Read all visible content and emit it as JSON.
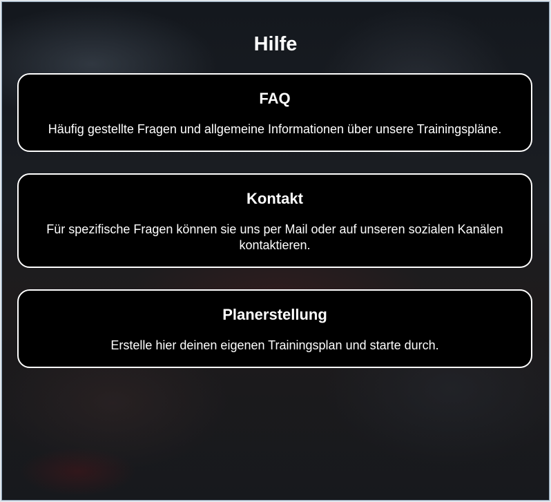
{
  "page": {
    "title": "Hilfe"
  },
  "cards": [
    {
      "title": "FAQ",
      "text": "Häufig gestellte Fragen und allgemeine Informationen über unsere Trainingspläne."
    },
    {
      "title": "Kontakt",
      "text": "Für spezifische Fragen können sie uns per Mail oder auf unseren sozialen Kanälen kontaktieren."
    },
    {
      "title": "Planerstellung",
      "text": "Erstelle hier deinen eigenen Trainingsplan und starte durch."
    }
  ],
  "colors": {
    "card_background": "#000000",
    "card_border": "#ffffff",
    "text": "#ffffff",
    "page_background": "#1b1e23"
  }
}
